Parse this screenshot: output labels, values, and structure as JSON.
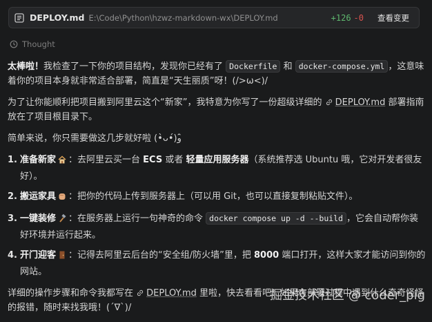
{
  "file_bar": {
    "file_name": "DEPLOY.md",
    "file_path": "E:\\Code\\Python\\hzwz-markdown-wx\\DEPLOY.md",
    "additions": "+126",
    "deletions": "-0",
    "view_changes": "查看变更"
  },
  "thought_label": "Thought",
  "p1": {
    "lead": "太棒啦！",
    "t1": "我检查了一下你的项目结构，发现你已经有了",
    "code1": "Dockerfile",
    "t2": "和",
    "code2": "docker-compose.yml",
    "t3": "，这意味着你的项目本身就非常适合部署，简直是“天生丽质”呀！(/>ω<)/"
  },
  "p2": {
    "t1": "为了让你能顺利把项目搬到阿里云这个“新家”，我特意为你写了一份超级详细的",
    "link": "DEPLOY.md",
    "t2": "部署指南放在了项目根目录下。"
  },
  "p3": "简单来说，你只需要做这几步就好啦 (•̀ᴗ•́)و ̑̑",
  "steps": [
    {
      "num": "1.",
      "title": "准备新家",
      "icon": "house-emoji",
      "t1": "：去阿里云买一台",
      "b1": "ECS",
      "t2": "或者",
      "b2": "轻量应用服务器",
      "t3": "（系统推荐选 Ubuntu 哦，它对开发者很友好）。"
    },
    {
      "num": "2.",
      "title": "搬运家具",
      "icon": "hand-emoji",
      "text": "：把你的代码上传到服务器上（可以用 Git，也可以直接复制粘贴文件）。"
    },
    {
      "num": "3.",
      "title": "一键装修",
      "icon": "hammer-emoji",
      "t1": "：在服务器上运行一句神奇的命令",
      "code": "docker compose up -d --build",
      "t2": "，它会自动帮你装好环境并运行起来。"
    },
    {
      "num": "4.",
      "title": "开门迎客",
      "icon": "door-emoji",
      "t1": "：记得去阿里云后台的“安全组/防火墙”里，把",
      "b1": "8000",
      "t2": "端口打开，这样大家才能访问到你的网站。"
    }
  ],
  "p4": {
    "t1": "详细的操作步骤和命令我都写在",
    "link": "DEPLOY.md",
    "t2": "里啦，快去看看吧！如果在部署过程中遇到什么奇奇怪怪的报错，随时来找我哦！(´∇`)/"
  },
  "watermark": "掘金技术社区 @ coder_pig"
}
